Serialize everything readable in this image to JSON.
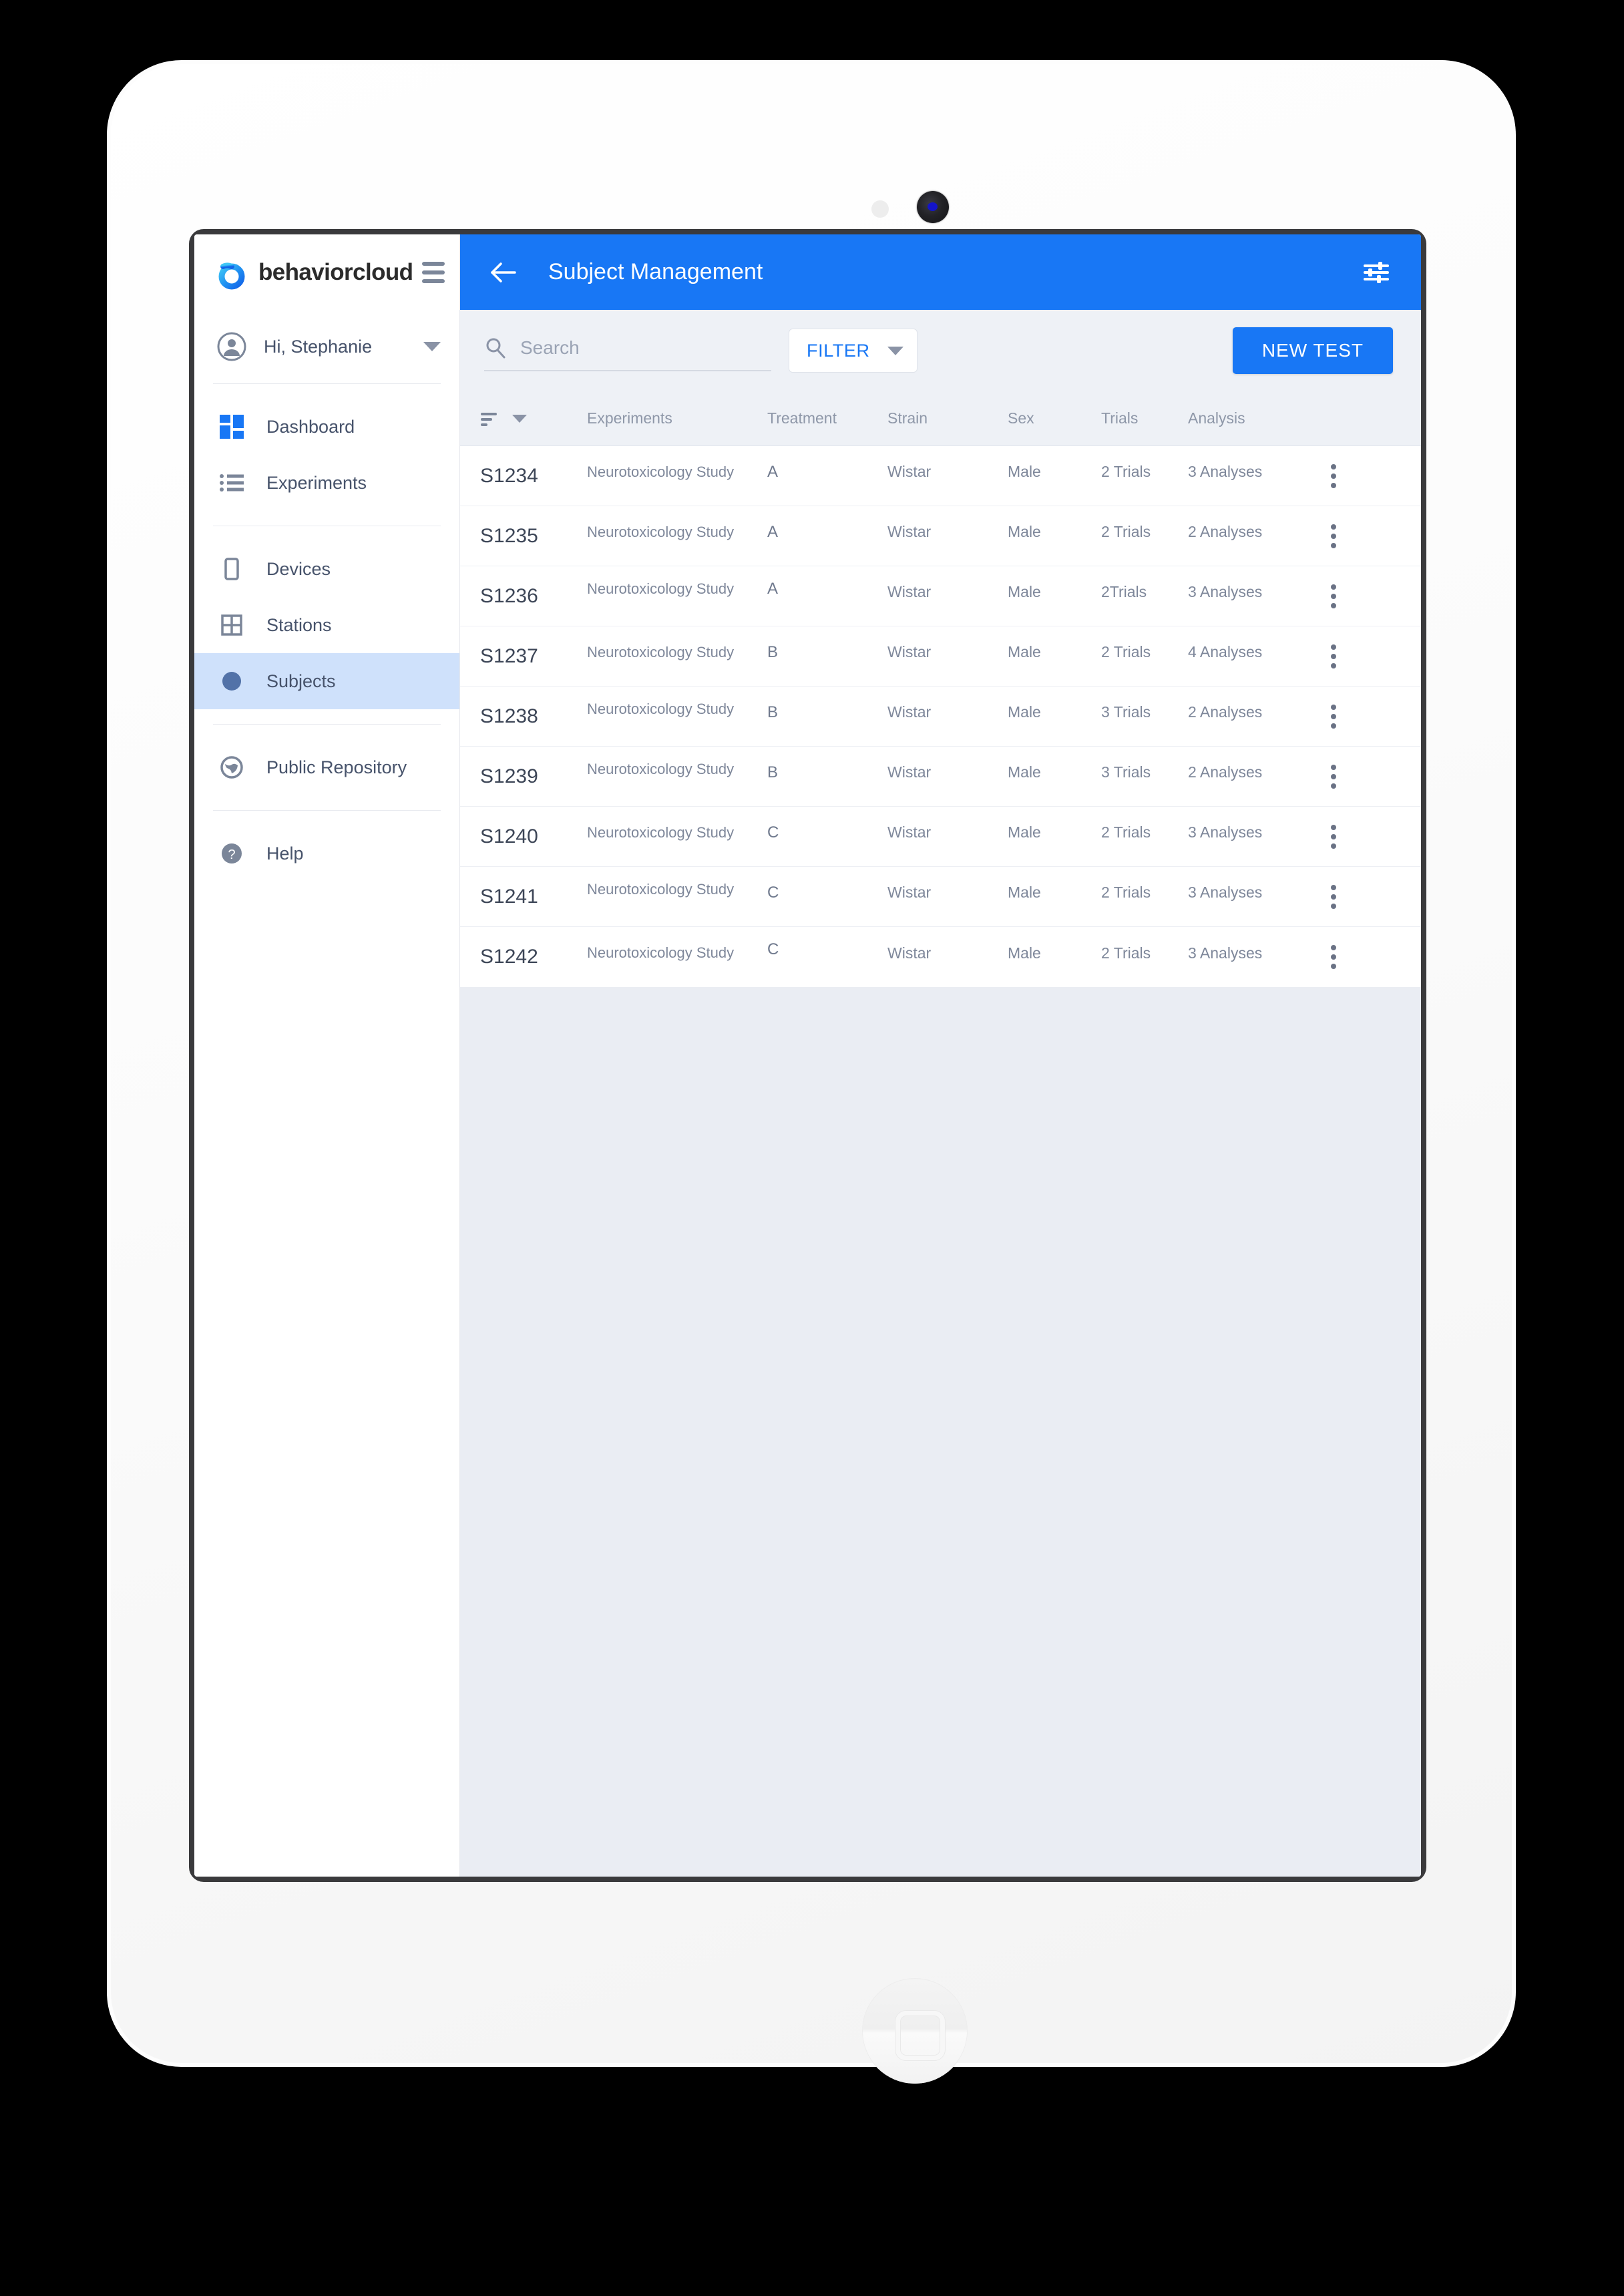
{
  "device": {
    "camera_icon": "camera-lens",
    "sensor_icon": "light-sensor",
    "home_button_icon": "home-button"
  },
  "sidebar": {
    "brand": {
      "name": "behaviorcloud",
      "logo_icon": "behaviorcloud-logo",
      "menu_icon": "hamburger-menu-icon"
    },
    "user": {
      "greeting": "Hi, Stephanie",
      "avatar_icon": "account-circle-icon",
      "expand_icon": "chevron-down-icon"
    },
    "groups": [
      {
        "items": [
          {
            "label": "Dashboard",
            "icon": "dashboard-icon",
            "active": false
          },
          {
            "label": "Experiments",
            "icon": "list-icon",
            "active": false
          }
        ]
      },
      {
        "items": [
          {
            "label": "Devices",
            "icon": "tablet-icon",
            "active": false
          },
          {
            "label": "Stations",
            "icon": "grid-icon",
            "active": false
          },
          {
            "label": "Subjects",
            "icon": "circle-icon",
            "active": true
          }
        ]
      },
      {
        "items": [
          {
            "label": "Public Repository",
            "icon": "globe-icon",
            "active": false
          }
        ]
      },
      {
        "items": [
          {
            "label": "Help",
            "icon": "help-circle-icon",
            "active": false
          }
        ]
      }
    ]
  },
  "appbar": {
    "title": "Subject Management",
    "back_icon": "arrow-back-icon",
    "tune_icon": "tune-settings-icon",
    "background_color": "#1877f5"
  },
  "toolbar": {
    "search": {
      "placeholder": "Search",
      "value": "",
      "icon": "search-icon"
    },
    "filter": {
      "label": "FILTER",
      "caret_icon": "chevron-down-icon",
      "color": "#1877f5"
    },
    "new_test": {
      "label": "NEW TEST",
      "color": "#1877f5"
    }
  },
  "table": {
    "sort_icon": "sort-list-icon",
    "sort_caret_icon": "chevron-down-icon",
    "row_menu_icon": "more-vertical-icon",
    "columns": [
      "",
      "Experiments",
      "Treatment",
      "Strain",
      "Sex",
      "Trials",
      "Analysis"
    ],
    "rows": [
      {
        "id": "S1234",
        "experiment": "Neurotoxicology Study",
        "treatment": "A",
        "strain": "Wistar",
        "sex": "Male",
        "trials": "2 Trials",
        "analysis": "3 Analyses"
      },
      {
        "id": "S1235",
        "experiment": "Neurotoxicology Study",
        "treatment": "A",
        "strain": "Wistar",
        "sex": "Male",
        "trials": "2 Trials",
        "analysis": "2 Analyses"
      },
      {
        "id": "S1236",
        "experiment": "Neurotoxicology Study",
        "treatment": "A",
        "strain": "Wistar",
        "sex": "Male",
        "trials": "2Trials",
        "analysis": "3 Analyses"
      },
      {
        "id": "S1237",
        "experiment": "Neurotoxicology Study",
        "treatment": "B",
        "strain": "Wistar",
        "sex": "Male",
        "trials": "2 Trials",
        "analysis": "4 Analyses"
      },
      {
        "id": "S1238",
        "experiment": "Neurotoxicology Study",
        "treatment": "B",
        "strain": "Wistar",
        "sex": "Male",
        "trials": "3 Trials",
        "analysis": "2 Analyses"
      },
      {
        "id": "S1239",
        "experiment": "Neurotoxicology Study",
        "treatment": "B",
        "strain": "Wistar",
        "sex": "Male",
        "trials": "3 Trials",
        "analysis": "2 Analyses"
      },
      {
        "id": "S1240",
        "experiment": "Neurotoxicology Study",
        "treatment": "C",
        "strain": "Wistar",
        "sex": "Male",
        "trials": "2 Trials",
        "analysis": "3 Analyses"
      },
      {
        "id": "S1241",
        "experiment": "Neurotoxicology Study",
        "treatment": "C",
        "strain": "Wistar",
        "sex": "Male",
        "trials": "2 Trials",
        "analysis": "3 Analyses"
      },
      {
        "id": "S1242",
        "experiment": "Neurotoxicology Study",
        "treatment": "C",
        "strain": "Wistar",
        "sex": "Male",
        "trials": "2 Trials",
        "analysis": "3 Analyses"
      }
    ]
  }
}
